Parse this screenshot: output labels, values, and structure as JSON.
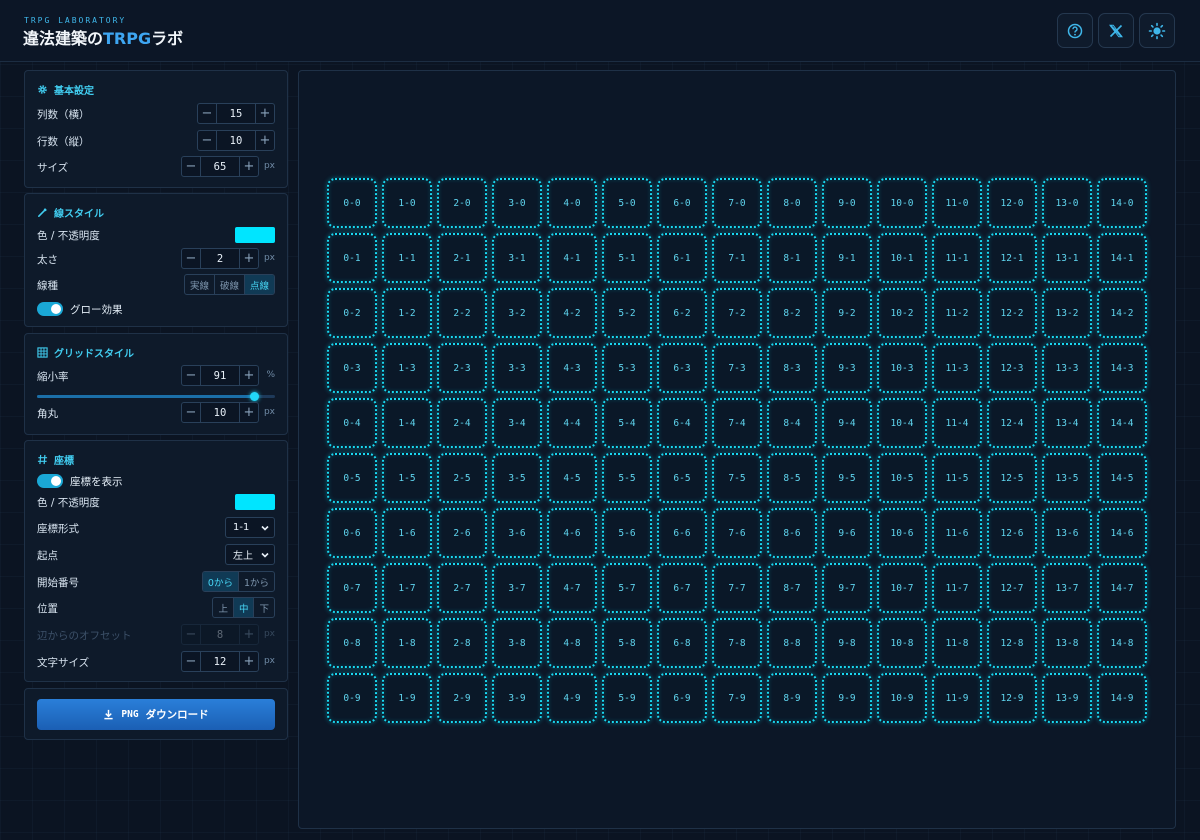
{
  "header": {
    "subtitle": "TRPG LABORATORY",
    "title_main": "違法建築の",
    "title_accent": "TRPG",
    "title_suffix": "ラボ",
    "buttons": [
      {
        "icon": "help-circle-icon"
      },
      {
        "icon": "x-logo-icon"
      },
      {
        "icon": "sun-icon"
      }
    ]
  },
  "basic": {
    "title": "基本設定",
    "cols_label": "列数（横）",
    "cols_value": "15",
    "rows_label": "行数（縦）",
    "rows_value": "10",
    "size_label": "サイズ",
    "size_value": "65",
    "size_unit": "px"
  },
  "line": {
    "title": "線スタイル",
    "color_label": "色 / 不透明度",
    "color": "#00e5ff",
    "width_label": "太さ",
    "width_value": "2",
    "width_unit": "px",
    "type_label": "線種",
    "types": [
      "実線",
      "破線",
      "点線"
    ],
    "active_type": "点線",
    "glow_label": "グロー効果",
    "glow_on": true
  },
  "gridstyle": {
    "title": "グリッドスタイル",
    "scale_label": "縮小率",
    "scale_value": "91",
    "scale_unit": "%",
    "scale_fraction": 0.91,
    "radius_label": "角丸",
    "radius_value": "10",
    "radius_unit": "px"
  },
  "coords": {
    "title": "座標",
    "show_label": "座標を表示",
    "show_on": true,
    "color_label": "色 / 不透明度",
    "color": "#00e5ff",
    "format_label": "座標形式",
    "format_value": "1-1",
    "origin_label": "起点",
    "origin_value": "左上",
    "start_label": "開始番号",
    "start_options": [
      "0から",
      "1から"
    ],
    "start_active": "0から",
    "position_label": "位置",
    "position_options": [
      "上",
      "中",
      "下"
    ],
    "position_active": "中",
    "offset_label": "辺からのオフセット",
    "offset_value": "8",
    "offset_unit": "px",
    "fontsize_label": "文字サイズ",
    "fontsize_value": "12",
    "fontsize_unit": "px"
  },
  "download": {
    "format": "PNG",
    "label": "ダウンロード"
  },
  "grid": {
    "columns": 15,
    "rows": 10,
    "line_color": "#19d9f2",
    "label_separator": "-"
  },
  "colors": {
    "accent": "#41cdf0",
    "primary_button": "#2a7fd9"
  }
}
